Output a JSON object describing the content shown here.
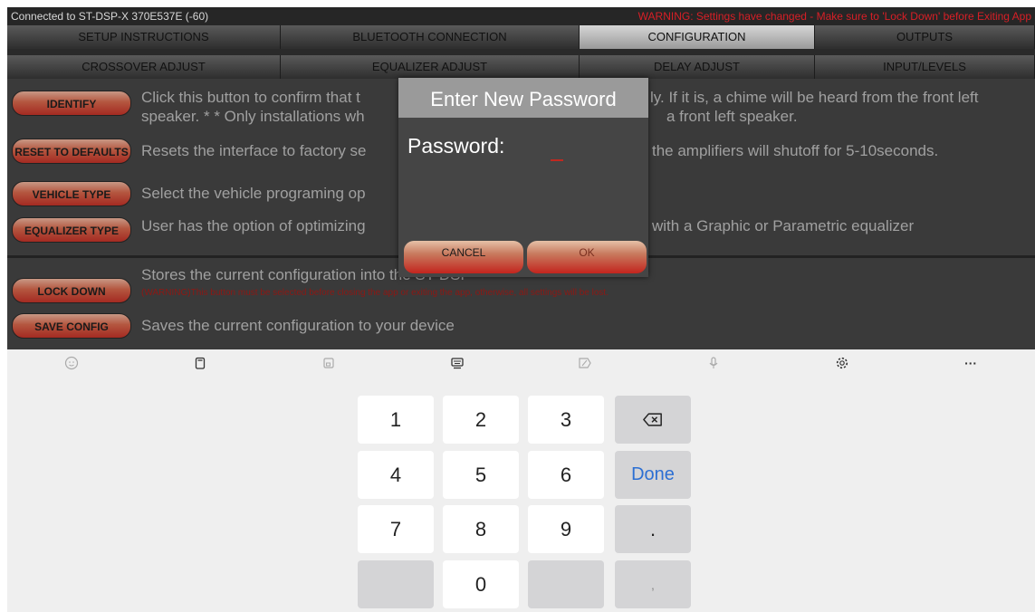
{
  "status": {
    "connection": "Connected to ST-DSP-X  370E537E (-60)",
    "warning": "WARNING: Settings have changed - Make sure to 'Lock Down' before Exiting App"
  },
  "tabs_row1": [
    "SETUP INSTRUCTIONS",
    "BLUETOOTH CONNECTION",
    "CONFIGURATION",
    "OUTPUTS"
  ],
  "tabs_row2": [
    "CROSSOVER ADJUST",
    "EQUALIZER ADJUST",
    "DELAY ADJUST",
    "INPUT/LEVELS"
  ],
  "active_tab": "CONFIGURATION",
  "config": {
    "identify_btn": "IDENTIFY",
    "identify_l1a": "Click this button to confirm that t",
    "identify_l1b": "ly. If it is, a chime will be heard from the front left",
    "identify_l2a": "speaker. * * Only installations wh",
    "identify_l2b": "a front left speaker.",
    "reset_btn": "RESET TO DEFAULTS",
    "reset_a": "Resets the interface to factory se",
    "reset_b": "the amplifiers will shutoff for 5-10seconds.",
    "vehicle_btn": "VEHICLE TYPE",
    "vehicle_a": "Select the vehicle programing op",
    "eq_btn": "EQUALIZER TYPE",
    "eq_a": "User has the option of optimizing",
    "eq_b": "with a Graphic or Parametric equalizer",
    "lock_btn": "LOCK DOWN",
    "lock_desc": "Stores the current configuration into the ST-DSP",
    "lock_note": "(WARNING)This button must be selected before closing the app or exiting the app, otherwise, all settings will be lost.",
    "save_btn": "SAVE CONFIG",
    "save_desc": "Saves the current configuration to your device"
  },
  "dialog": {
    "title": "Enter New Password",
    "label": "Password:",
    "cancel": "CANCEL",
    "ok": "OK"
  },
  "keyboard": {
    "toolbar_icons": [
      "emoji-icon",
      "clipboard-icon",
      "keyboard-resize-icon",
      "keyboard-icon",
      "handwriting-icon",
      "microphone-icon",
      "settings-icon",
      "more-icon"
    ],
    "more": "···",
    "keys": [
      "1",
      "2",
      "3",
      "4",
      "5",
      "6",
      "7",
      "8",
      "9",
      "0"
    ],
    "done": "Done",
    "dot": ".",
    "comma": ","
  }
}
